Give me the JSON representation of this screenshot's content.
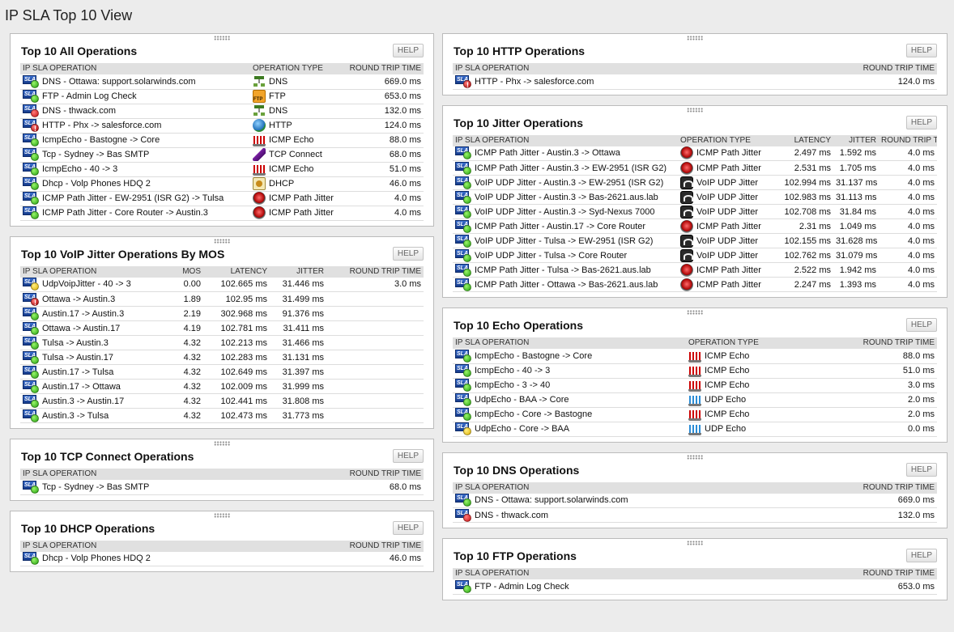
{
  "page": {
    "title": "IP SLA Top 10 View"
  },
  "help_label": "HELP",
  "panels": {
    "all": {
      "title": "Top 10 All Operations",
      "headers": [
        "IP SLA OPERATION",
        "OPERATION TYPE",
        "ROUND TRIP TIME"
      ],
      "rows": [
        {
          "op": "DNS - Ottawa: support.solarwinds.com",
          "status": "up",
          "type": "DNS",
          "type_icon": "dns",
          "rtt": "669.0 ms"
        },
        {
          "op": "FTP - Admin Log Check",
          "status": "up",
          "type": "FTP",
          "type_icon": "ftp",
          "rtt": "653.0 ms"
        },
        {
          "op": "DNS - thwack.com",
          "status": "down",
          "type": "DNS",
          "type_icon": "dns",
          "rtt": "132.0 ms"
        },
        {
          "op": "HTTP - Phx -> salesforce.com",
          "status": "crit",
          "type": "HTTP",
          "type_icon": "http",
          "rtt": "124.0 ms"
        },
        {
          "op": "IcmpEcho - Bastogne -> Core",
          "status": "up",
          "type": "ICMP Echo",
          "type_icon": "icmp",
          "rtt": "88.0 ms"
        },
        {
          "op": "Tcp - Sydney -> Bas SMTP",
          "status": "up",
          "type": "TCP Connect",
          "type_icon": "tcp",
          "rtt": "68.0 ms"
        },
        {
          "op": "IcmpEcho - 40 -> 3",
          "status": "up",
          "type": "ICMP Echo",
          "type_icon": "icmp",
          "rtt": "51.0 ms"
        },
        {
          "op": "Dhcp - Volp Phones HDQ 2",
          "status": "up",
          "type": "DHCP",
          "type_icon": "dhcp",
          "rtt": "46.0 ms"
        },
        {
          "op": "ICMP Path Jitter - EW-2951 (ISR G2) -> Tulsa",
          "status": "up",
          "type": "ICMP Path Jitter",
          "type_icon": "path",
          "rtt": "4.0 ms"
        },
        {
          "op": "ICMP Path Jitter - Core Router -> Austin.3",
          "status": "up",
          "type": "ICMP Path Jitter",
          "type_icon": "path",
          "rtt": "4.0 ms"
        }
      ]
    },
    "voip": {
      "title": "Top 10 VoIP Jitter Operations By MOS",
      "headers": [
        "IP SLA OPERATION",
        "MOS",
        "LATENCY",
        "JITTER",
        "ROUND TRIP TIME"
      ],
      "rows": [
        {
          "op": "UdpVoipJitter - 40 -> 3",
          "status": "warn",
          "mos": "0.00",
          "latency": "102.665 ms",
          "jitter": "31.446 ms",
          "rtt": "3.0 ms"
        },
        {
          "op": "Ottawa -> Austin.3",
          "status": "crit",
          "mos": "1.89",
          "latency": "102.95 ms",
          "jitter": "31.499 ms",
          "rtt": ""
        },
        {
          "op": "Austin.17 -> Austin.3",
          "status": "up",
          "mos": "2.19",
          "latency": "302.968 ms",
          "jitter": "91.376 ms",
          "rtt": ""
        },
        {
          "op": "Ottawa -> Austin.17",
          "status": "up",
          "mos": "4.19",
          "latency": "102.781 ms",
          "jitter": "31.411 ms",
          "rtt": ""
        },
        {
          "op": "Tulsa -> Austin.3",
          "status": "up",
          "mos": "4.32",
          "latency": "102.213 ms",
          "jitter": "31.466 ms",
          "rtt": ""
        },
        {
          "op": "Tulsa -> Austin.17",
          "status": "up",
          "mos": "4.32",
          "latency": "102.283 ms",
          "jitter": "31.131 ms",
          "rtt": ""
        },
        {
          "op": "Austin.17 -> Tulsa",
          "status": "up",
          "mos": "4.32",
          "latency": "102.649 ms",
          "jitter": "31.397 ms",
          "rtt": ""
        },
        {
          "op": "Austin.17 -> Ottawa",
          "status": "up",
          "mos": "4.32",
          "latency": "102.009 ms",
          "jitter": "31.999 ms",
          "rtt": ""
        },
        {
          "op": "Austin.3 -> Austin.17",
          "status": "up",
          "mos": "4.32",
          "latency": "102.441 ms",
          "jitter": "31.808 ms",
          "rtt": ""
        },
        {
          "op": "Austin.3 -> Tulsa",
          "status": "up",
          "mos": "4.32",
          "latency": "102.473 ms",
          "jitter": "31.773 ms",
          "rtt": ""
        }
      ]
    },
    "tcp": {
      "title": "Top 10 TCP Connect Operations",
      "headers": [
        "IP SLA OPERATION",
        "ROUND TRIP TIME"
      ],
      "rows": [
        {
          "op": "Tcp - Sydney -> Bas SMTP",
          "status": "up",
          "rtt": "68.0 ms"
        }
      ]
    },
    "dhcp": {
      "title": "Top 10 DHCP Operations",
      "headers": [
        "IP SLA OPERATION",
        "ROUND TRIP TIME"
      ],
      "rows": [
        {
          "op": "Dhcp - Volp Phones HDQ 2",
          "status": "up",
          "rtt": "46.0 ms"
        }
      ]
    },
    "http": {
      "title": "Top 10 HTTP Operations",
      "headers": [
        "IP SLA OPERATION",
        "ROUND TRIP TIME"
      ],
      "rows": [
        {
          "op": "HTTP - Phx -> salesforce.com",
          "status": "crit",
          "rtt": "124.0 ms"
        }
      ]
    },
    "jitter": {
      "title": "Top 10 Jitter Operations",
      "headers": [
        "IP SLA OPERATION",
        "OPERATION TYPE",
        "LATENCY",
        "JITTER",
        "ROUND TRIP TIME"
      ],
      "rows": [
        {
          "op": "ICMP Path Jitter - Austin.3 -> Ottawa",
          "status": "up",
          "type": "ICMP Path Jitter",
          "type_icon": "path",
          "latency": "2.497 ms",
          "jitter": "1.592 ms",
          "rtt": "4.0 ms"
        },
        {
          "op": "ICMP Path Jitter - Austin.3 -> EW-2951 (ISR G2)",
          "status": "up",
          "type": "ICMP Path Jitter",
          "type_icon": "path",
          "latency": "2.531 ms",
          "jitter": "1.705 ms",
          "rtt": "4.0 ms"
        },
        {
          "op": "VoIP UDP Jitter - Austin.3 -> EW-2951 (ISR G2)",
          "status": "up",
          "type": "VoIP UDP Jitter",
          "type_icon": "voip",
          "latency": "102.994 ms",
          "jitter": "31.137 ms",
          "rtt": "4.0 ms"
        },
        {
          "op": "VoIP UDP Jitter - Austin.3 -> Bas-2621.aus.lab",
          "status": "up",
          "type": "VoIP UDP Jitter",
          "type_icon": "voip",
          "latency": "102.983 ms",
          "jitter": "31.113 ms",
          "rtt": "4.0 ms"
        },
        {
          "op": "VoIP UDP Jitter - Austin.3 -> Syd-Nexus 7000",
          "status": "up",
          "type": "VoIP UDP Jitter",
          "type_icon": "voip",
          "latency": "102.708 ms",
          "jitter": "31.84 ms",
          "rtt": "4.0 ms"
        },
        {
          "op": "ICMP Path Jitter - Austin.17 -> Core Router",
          "status": "up",
          "type": "ICMP Path Jitter",
          "type_icon": "path",
          "latency": "2.31 ms",
          "jitter": "1.049 ms",
          "rtt": "4.0 ms"
        },
        {
          "op": "VoIP UDP Jitter - Tulsa -> EW-2951 (ISR G2)",
          "status": "up",
          "type": "VoIP UDP Jitter",
          "type_icon": "voip",
          "latency": "102.155 ms",
          "jitter": "31.628 ms",
          "rtt": "4.0 ms"
        },
        {
          "op": "VoIP UDP Jitter - Tulsa -> Core Router",
          "status": "up",
          "type": "VoIP UDP Jitter",
          "type_icon": "voip",
          "latency": "102.762 ms",
          "jitter": "31.079 ms",
          "rtt": "4.0 ms"
        },
        {
          "op": "ICMP Path Jitter - Tulsa -> Bas-2621.aus.lab",
          "status": "up",
          "type": "ICMP Path Jitter",
          "type_icon": "path",
          "latency": "2.522 ms",
          "jitter": "1.942 ms",
          "rtt": "4.0 ms"
        },
        {
          "op": "ICMP Path Jitter - Ottawa -> Bas-2621.aus.lab",
          "status": "up",
          "type": "ICMP Path Jitter",
          "type_icon": "path",
          "latency": "2.247 ms",
          "jitter": "1.393 ms",
          "rtt": "4.0 ms"
        }
      ]
    },
    "echo": {
      "title": "Top 10 Echo Operations",
      "headers": [
        "IP SLA OPERATION",
        "OPERATION TYPE",
        "ROUND TRIP TIME"
      ],
      "rows": [
        {
          "op": "IcmpEcho - Bastogne -> Core",
          "status": "up",
          "type": "ICMP Echo",
          "type_icon": "icmp",
          "rtt": "88.0 ms"
        },
        {
          "op": "IcmpEcho - 40 -> 3",
          "status": "up",
          "type": "ICMP Echo",
          "type_icon": "icmp",
          "rtt": "51.0 ms"
        },
        {
          "op": "IcmpEcho - 3 -> 40",
          "status": "up",
          "type": "ICMP Echo",
          "type_icon": "icmp",
          "rtt": "3.0 ms"
        },
        {
          "op": "UdpEcho - BAA -> Core",
          "status": "up",
          "type": "UDP Echo",
          "type_icon": "udp",
          "rtt": "2.0 ms"
        },
        {
          "op": "IcmpEcho - Core -> Bastogne",
          "status": "up",
          "type": "ICMP Echo",
          "type_icon": "icmp",
          "rtt": "2.0 ms"
        },
        {
          "op": "UdpEcho - Core -> BAA",
          "status": "warn",
          "type": "UDP Echo",
          "type_icon": "udp",
          "rtt": "0.0 ms"
        }
      ]
    },
    "dns": {
      "title": "Top 10 DNS Operations",
      "headers": [
        "IP SLA OPERATION",
        "ROUND TRIP TIME"
      ],
      "rows": [
        {
          "op": "DNS - Ottawa: support.solarwinds.com",
          "status": "up",
          "rtt": "669.0 ms"
        },
        {
          "op": "DNS - thwack.com",
          "status": "down",
          "rtt": "132.0 ms"
        }
      ]
    },
    "ftp": {
      "title": "Top 10 FTP Operations",
      "headers": [
        "IP SLA OPERATION",
        "ROUND TRIP TIME"
      ],
      "rows": [
        {
          "op": "FTP - Admin Log Check",
          "status": "up",
          "rtt": "653.0 ms"
        }
      ]
    }
  }
}
